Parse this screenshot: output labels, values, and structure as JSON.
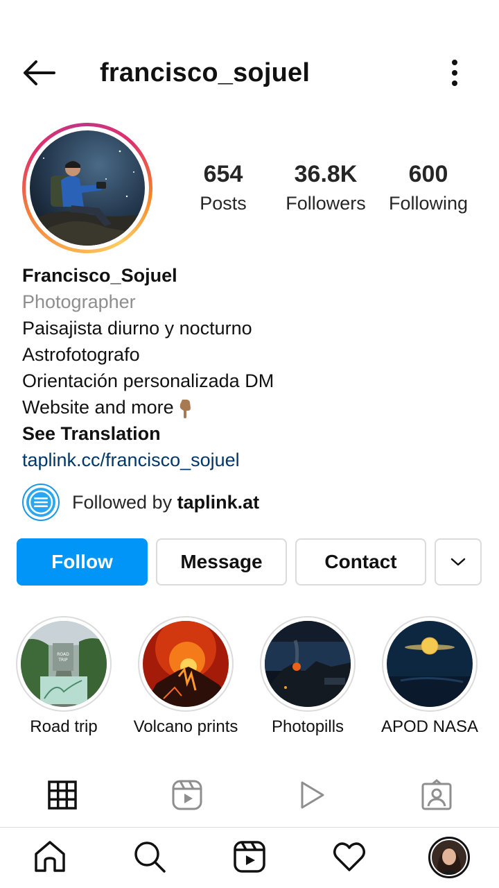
{
  "header": {
    "username": "francisco_sojuel",
    "back_icon": "arrow-left-icon",
    "more_icon": "more-vertical-icon"
  },
  "stats": [
    {
      "value": "654",
      "label": "Posts"
    },
    {
      "value": "36.8K",
      "label": "Followers"
    },
    {
      "value": "600",
      "label": "Following"
    }
  ],
  "bio": {
    "name": "Francisco_Sojuel",
    "category": "Photographer",
    "lines": [
      "Paisajista diurno y nocturno",
      "Astrofotografo",
      "Orientación personalizada DM",
      "Website and more"
    ],
    "emoji": "👇🏽",
    "see_translation": "See Translation",
    "link": "taplink.cc/francisco_sojuel"
  },
  "followed_by": {
    "prefix": "Followed by ",
    "account": "taplink.at"
  },
  "actions": {
    "follow": "Follow",
    "message": "Message",
    "contact": "Contact",
    "more_icon": "chevron-down-icon"
  },
  "highlights": [
    {
      "label": "Road trip"
    },
    {
      "label": "Volcano prints"
    },
    {
      "label": "Photopills"
    },
    {
      "label": "APOD NASA"
    }
  ],
  "profile_tabs": [
    "grid-icon",
    "reels-icon",
    "video-play-icon",
    "tagged-icon"
  ],
  "bottom_nav": [
    "home-icon",
    "search-icon",
    "reels-icon",
    "heart-icon",
    "profile-avatar"
  ],
  "colors": {
    "accent": "#0095f6",
    "link": "#00376b",
    "muted": "#8e8e8e",
    "border": "#dbdbdb"
  }
}
